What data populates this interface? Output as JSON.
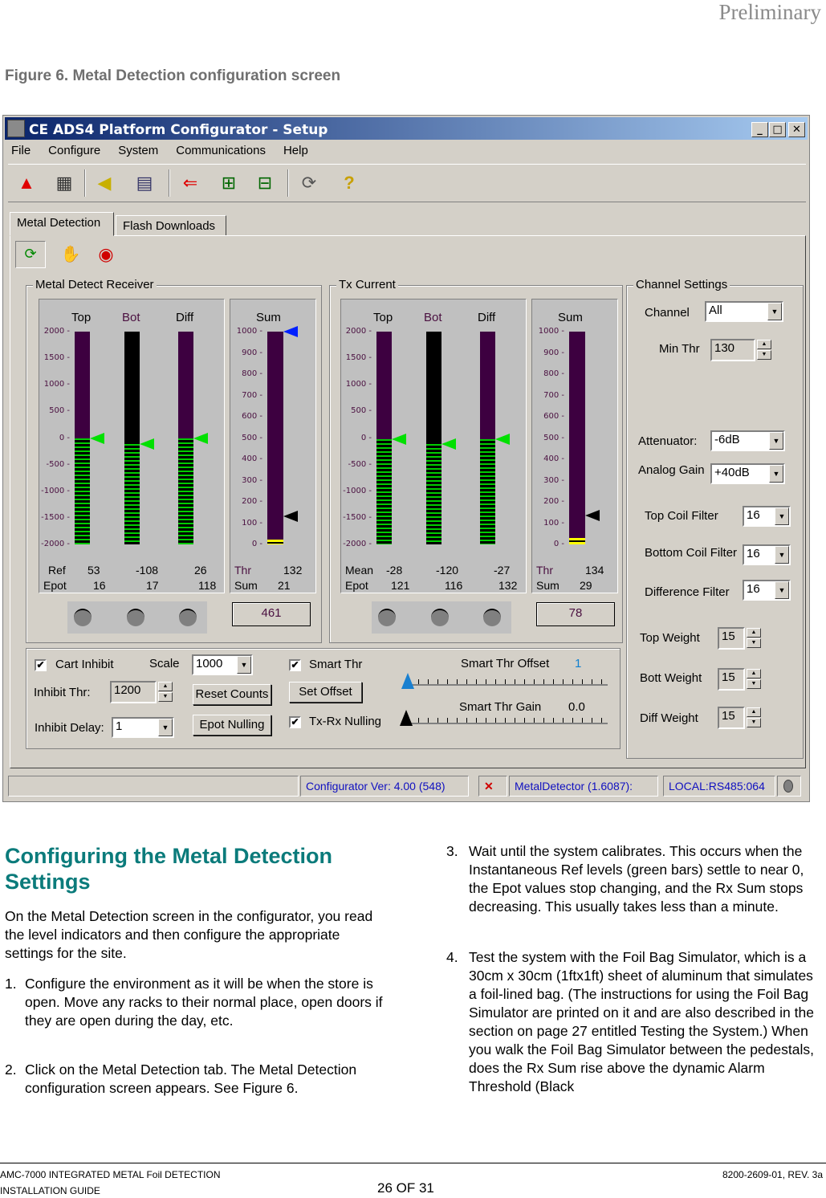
{
  "header": {
    "prelim": "Preliminary",
    "figure_caption": "Figure 6. Metal Detection configuration screen"
  },
  "window": {
    "title": "CE ADS4 Platform Configurator - Setup",
    "controls": {
      "minimize": "_",
      "maximize": "□",
      "close": "✕"
    },
    "menu": [
      "File",
      "Configure",
      "System",
      "Communications",
      "Help"
    ],
    "toolbar": [
      {
        "icon": "alarm-warning-icon",
        "glyph": "▲"
      },
      {
        "icon": "chip-icon",
        "glyph": "▦"
      },
      {
        "icon": "speaker-icon",
        "glyph": "◀"
      },
      {
        "icon": "table-edit-icon",
        "glyph": "▤"
      },
      {
        "icon": "connect-icon",
        "glyph": "⇐"
      },
      {
        "icon": "network-computer-icon",
        "glyph": "⊞"
      },
      {
        "icon": "network-icon",
        "glyph": "⊟"
      },
      {
        "icon": "refresh-doc-icon",
        "glyph": "⟳"
      },
      {
        "icon": "help-icon",
        "glyph": "?"
      }
    ],
    "tabs": [
      "Metal Detection",
      "Flash Downloads"
    ],
    "subtoolbar": [
      {
        "icon": "refresh-icon",
        "glyph": "⟳"
      },
      {
        "icon": "hand-icon",
        "glyph": "✋"
      },
      {
        "icon": "alarm-mute-icon",
        "glyph": "◉"
      }
    ],
    "receiver": {
      "title": "Metal Detect Receiver",
      "headers": {
        "top": "Top",
        "bot": "Bot",
        "diff": "Diff",
        "sum": "Sum"
      },
      "scale_ticks": [
        "2000",
        "1500",
        "1000",
        "500",
        "0",
        "-500",
        "-1000",
        "-1500",
        "-2000"
      ],
      "sum_ticks": [
        "1000",
        "900",
        "800",
        "700",
        "600",
        "500",
        "400",
        "300",
        "200",
        "100",
        "0"
      ],
      "ref_label": "Ref",
      "epot_label": "Epot",
      "ref": [
        "53",
        "-108",
        "26"
      ],
      "epot": [
        "16",
        "17",
        "118"
      ],
      "thr_label": "Thr",
      "thr": "132",
      "sum_label": "Sum",
      "sum": "21",
      "sum_box": "461",
      "bar_levels": [
        0,
        -108,
        0
      ],
      "sum_level": 21,
      "thr_marker": 132,
      "max_marker": 1000
    },
    "tx": {
      "title": "Tx Current",
      "headers": {
        "top": "Top",
        "bot": "Bot",
        "diff": "Diff",
        "sum": "Sum"
      },
      "mean_label": "Mean",
      "epot_label": "Epot",
      "mean": [
        "-28",
        "-120",
        "-27"
      ],
      "epot": [
        "121",
        "116",
        "132"
      ],
      "thr_label": "Thr",
      "thr": "134",
      "sum_label": "Sum",
      "sum": "29",
      "sum_box": "78",
      "bar_levels": [
        -28,
        -120,
        -27
      ],
      "sum_level": 29,
      "thr_marker": 134
    },
    "channel": {
      "title": "Channel Settings",
      "channel_label": "Channel",
      "channel_value": "All",
      "min_thr_label": "Min Thr",
      "min_thr_value": "130",
      "attenuator_label": "Attenuator:",
      "attenuator_value": "-6dB",
      "analog_gain_label": "Analog Gain",
      "analog_gain_value": "+40dB",
      "top_coil_filter_label": "Top Coil Filter",
      "top_coil_filter_value": "16",
      "bottom_coil_filter_label": "Bottom Coil Filter",
      "bottom_coil_filter_value": "16",
      "difference_filter_label": "Difference Filter",
      "difference_filter_value": "16",
      "top_weight_label": "Top Weight",
      "top_weight_value": "15",
      "bott_weight_label": "Bott Weight",
      "bott_weight_value": "15",
      "diff_weight_label": "Diff Weight",
      "diff_weight_value": "15"
    },
    "bottom": {
      "cart_inhibit_label": "Cart Inhibit",
      "cart_inhibit_checked": "✔",
      "scale_label": "Scale",
      "scale_value": "1000",
      "inhibit_thr_label": "Inhibit Thr:",
      "inhibit_thr_value": "1200",
      "inhibit_delay_label": "Inhibit Delay:",
      "inhibit_delay_value": "1",
      "reset_counts": "Reset Counts",
      "epot_nulling": "Epot Nulling",
      "smart_thr_label": "Smart Thr",
      "smart_thr_checked": "✔",
      "set_offset": "Set Offset",
      "txrx_nulling_label": "Tx-Rx Nulling",
      "txrx_nulling_checked": "✔",
      "smart_thr_offset_label": "Smart Thr Offset",
      "smart_thr_offset_value": "1",
      "smart_thr_gain_label": "Smart Thr Gain",
      "smart_thr_gain_value": "0.0"
    },
    "statusbar": {
      "version": "Configurator Ver: 4.00 (548)",
      "device": "MetalDetector (1.6087):",
      "port": "LOCAL:RS485:064"
    }
  },
  "content": {
    "heading": "Configuring the Metal Detection Settings",
    "intro": "On the Metal Detection screen in the configurator, you read the level indicators and then configure the appropriate settings for the site.",
    "steps": [
      {
        "n": "1.",
        "text": "Configure the environment as it will be when the store is open. Move any racks to their normal place, open doors if they are open during the day, etc."
      },
      {
        "n": "2.",
        "text": "Click on the Metal Detection tab. The Metal Detection configuration screen appears. See Figure 6."
      },
      {
        "n": "3.",
        "text": "Wait until the system calibrates. This occurs when the Instantaneous Ref levels (green bars) settle to near 0, the Epot values stop changing, and the Rx Sum stops decreasing. This usually takes less than a minute."
      },
      {
        "n": "4.",
        "text": "Test the system with the Foil Bag Simulator, which is a 30cm x 30cm (1ftx1ft) sheet of aluminum that simulates a foil-lined bag. (The instructions for using the Foil Bag Simulator are printed on it and are also described in the section on page 27 entitled Testing the System.) When you walk the Foil Bag Simulator between the pedestals, does the Rx Sum rise above the dynamic Alarm Threshold (Black"
      }
    ]
  },
  "footer": {
    "left1": "AMC-7000 INTEGRATED METAL Foil DETECTION",
    "left2": "INSTALLATION GUIDE",
    "page": "26 OF 31",
    "right": "8200-2609-01, REV. 3a"
  }
}
